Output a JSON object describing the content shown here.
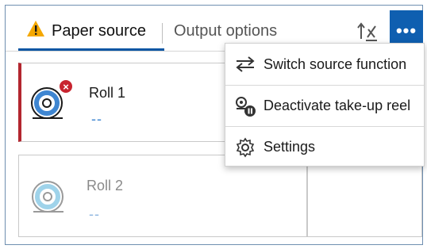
{
  "tabs": {
    "paper_source": "Paper source",
    "output_options": "Output options"
  },
  "more_button": {
    "label": "•••"
  },
  "rolls": [
    {
      "name": "Roll 1",
      "value": "--",
      "status": "error"
    },
    {
      "name": "Roll 2",
      "value": "--",
      "status": "disabled"
    }
  ],
  "menu": {
    "items": [
      {
        "label": "Switch source function",
        "icon": "switch-arrows-icon"
      },
      {
        "label": "Deactivate take-up reel",
        "icon": "take-up-reel-pause-icon"
      },
      {
        "label": "Settings",
        "icon": "gear-icon"
      }
    ]
  },
  "colors": {
    "accent": "#0f5fb0",
    "error": "#c8242f",
    "warning": "#f5a800"
  },
  "badges": {
    "error_symbol": "×"
  }
}
